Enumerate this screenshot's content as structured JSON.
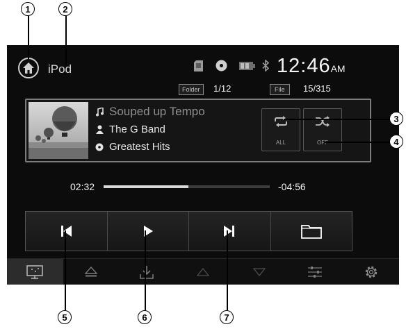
{
  "callouts": {
    "c1": "1",
    "c2": "2",
    "c3": "3",
    "c4": "4",
    "c5": "5",
    "c6": "6",
    "c7": "7"
  },
  "header": {
    "source_label": "iPod",
    "clock_time": "12:46",
    "clock_ampm": "AM",
    "status_icons": [
      "sd-card-icon",
      "disc-icon",
      "battery-icon",
      "bluetooth-icon"
    ]
  },
  "counters": {
    "folder_label": "Folder",
    "folder_value": "1/12",
    "file_label": "File",
    "file_value": "15/315"
  },
  "track": {
    "title": "Souped up Tempo",
    "artist": "The G Band",
    "album": "Greatest Hits"
  },
  "modes": {
    "repeat_label": "ALL",
    "shuffle_label": "OFF"
  },
  "playback": {
    "elapsed": "02:32",
    "remaining": "-04:56",
    "progress_fraction": 0.51
  },
  "transport_buttons": [
    "previous-track-icon",
    "play-icon",
    "next-track-icon",
    "folder-icon"
  ],
  "bottom_bar": [
    "screen-display-icon",
    "eject-icon",
    "download-icon",
    "up-arrow-icon",
    "down-arrow-icon",
    "equalizer-icon",
    "settings-gear-icon"
  ],
  "colors": {
    "screen_bg": "#0c0c0c",
    "text_primary": "#f0f0f0",
    "text_dim": "#8e8e8e",
    "panel_border": "#7d7d7d"
  }
}
